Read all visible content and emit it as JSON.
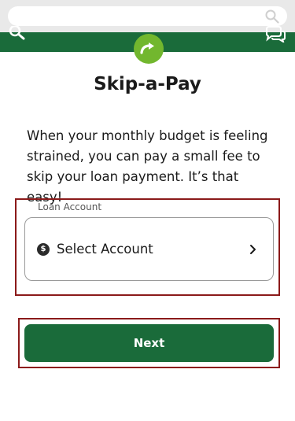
{
  "header": {
    "search_placeholder": "",
    "left_icon": "search-icon",
    "right_icon": "chat-icon",
    "badge_icon": "skip-arrow-icon"
  },
  "page": {
    "title": "Skip-a-Pay",
    "intro": "When your monthly budget is feeling strained, you can pay a small fee to skip your loan payment. It’s that easy!"
  },
  "form": {
    "loan_account_label": "Loan Account",
    "select_value": "Select Account",
    "select_icon_glyph": "$",
    "next_label": "Next"
  },
  "colors": {
    "brand_green": "#1a6b3a",
    "badge_green": "#72b72e",
    "highlight_frame": "#8b1a1a"
  }
}
